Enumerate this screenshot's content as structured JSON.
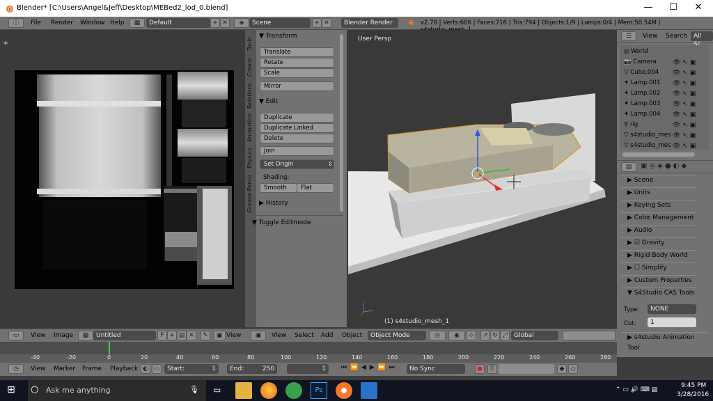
{
  "window": {
    "title": "Blender* [C:\\Users\\Angel&Jeff\\Desktop\\MEBed2_lod_0.blend]",
    "minimize": "—",
    "maximize": "☐",
    "close": "✕"
  },
  "topbar": {
    "menus": [
      "File",
      "Render",
      "Window",
      "Help"
    ],
    "layout": "Default",
    "scene": "Scene",
    "engine": "Blender Render",
    "stats": "v2.70 | Verts:606 | Faces:716 | Tris:794 | Objects:1/9 | Lamps:0/4 | Mem:50.54M | s4studio_mesh_1"
  },
  "toolshelf": {
    "tabs": [
      "Tools",
      "Create",
      "Relations",
      "Animation",
      "Physics",
      "Grease Pencil"
    ],
    "transform_header": "Transform",
    "translate": "Translate",
    "rotate": "Rotate",
    "scale": "Scale",
    "mirror": "Mirror",
    "edit_header": "Edit",
    "duplicate": "Duplicate",
    "duplicate_linked": "Duplicate Linked",
    "delete": "Delete",
    "join": "Join",
    "set_origin": "Set Origin",
    "shading_label": "Shading:",
    "smooth": "Smooth",
    "flat": "Flat",
    "history_header": "History",
    "toggle_editmode": "Toggle Editmode"
  },
  "viewport": {
    "view_label": "User Persp",
    "object_label": "(1) s4studio_mesh_1"
  },
  "outliner": {
    "view": "View",
    "search": "Search",
    "all_scenes": "All Sc",
    "items": [
      "World",
      "Camera",
      "Cube.004",
      "Lamp.001",
      "Lamp.002",
      "Lamp.003",
      "Lamp.004",
      "rig",
      "s4studio_mes",
      "s4studio_mes"
    ]
  },
  "properties": {
    "panels": [
      "Scene",
      "Units",
      "Keying Sets",
      "Color Management",
      "Audio",
      "Gravity",
      "Rigid Body World",
      "Simplify",
      "Custom Properties"
    ],
    "s4_header": "S4Studio CAS Tools",
    "type_label": "Type:",
    "type_value": "NONE",
    "cut_label": "Cut:",
    "cut_value": "1",
    "anim_tools": "s4studio Animation Tool"
  },
  "image_header": {
    "view": "View",
    "image": "Image",
    "image_name": "Untitled",
    "f": "F",
    "view2": "View"
  },
  "view3d_header": {
    "view": "View",
    "select": "Select",
    "add": "Add",
    "object": "Object",
    "mode": "Object Mode",
    "orientation": "Global"
  },
  "timeline": {
    "ticks": [
      "-40",
      "-20",
      "0",
      "20",
      "40",
      "60",
      "80",
      "100",
      "120",
      "140",
      "160",
      "180",
      "200",
      "220",
      "240",
      "260",
      "280"
    ],
    "current_frame": "1"
  },
  "playbar": {
    "view": "View",
    "marker": "Marker",
    "frame": "Frame",
    "playback": "Playback",
    "start": "Start:",
    "start_value": "1",
    "end": "End:",
    "end_value": "250",
    "frame_value": "1",
    "sync": "No Sync"
  },
  "taskbar": {
    "search": "Ask me anything",
    "time": "9:45 PM",
    "date": "3/28/2016"
  }
}
